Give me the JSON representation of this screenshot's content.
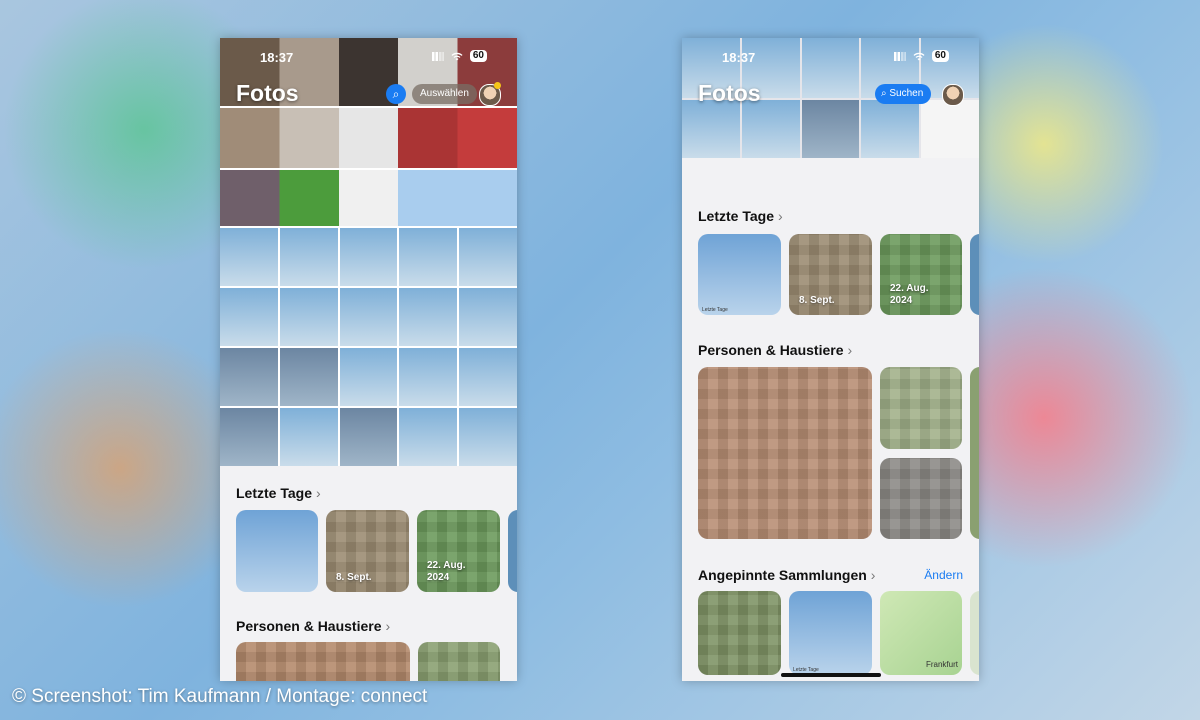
{
  "left": {
    "time": "18:37",
    "battery": "60",
    "title": "Fotos",
    "select_label": "Auswählen",
    "recent_days": "Letzte Tage",
    "recent_cards": [
      {
        "label": ""
      },
      {
        "label": "8. Sept."
      },
      {
        "label": "22. Aug.\n2024"
      }
    ],
    "people": "Personen & Haustiere",
    "chevron": "›"
  },
  "right": {
    "time": "18:37",
    "battery": "60",
    "title": "Fotos",
    "search_label": "Suchen",
    "recent_days": "Letzte Tage",
    "recent_cards": [
      {
        "label": "",
        "mini": "Letzte Tage"
      },
      {
        "label": "8. Sept."
      },
      {
        "label": "22. Aug.\n2024"
      }
    ],
    "people": "Personen & Haustiere",
    "pinned": "Angepinnte Sammlungen",
    "change": "Ändern",
    "pinned_cards": [
      {
        "label": ""
      },
      {
        "label": "",
        "mini": "Letzte Tage"
      },
      {
        "label": "",
        "mini": "Frankfurt"
      }
    ],
    "chevron": "›"
  },
  "caption": "© Screenshot: Tim Kaufmann / Montage: connect",
  "colors": {
    "accent": "#1a7cf2",
    "background": "#f2f2f4"
  }
}
